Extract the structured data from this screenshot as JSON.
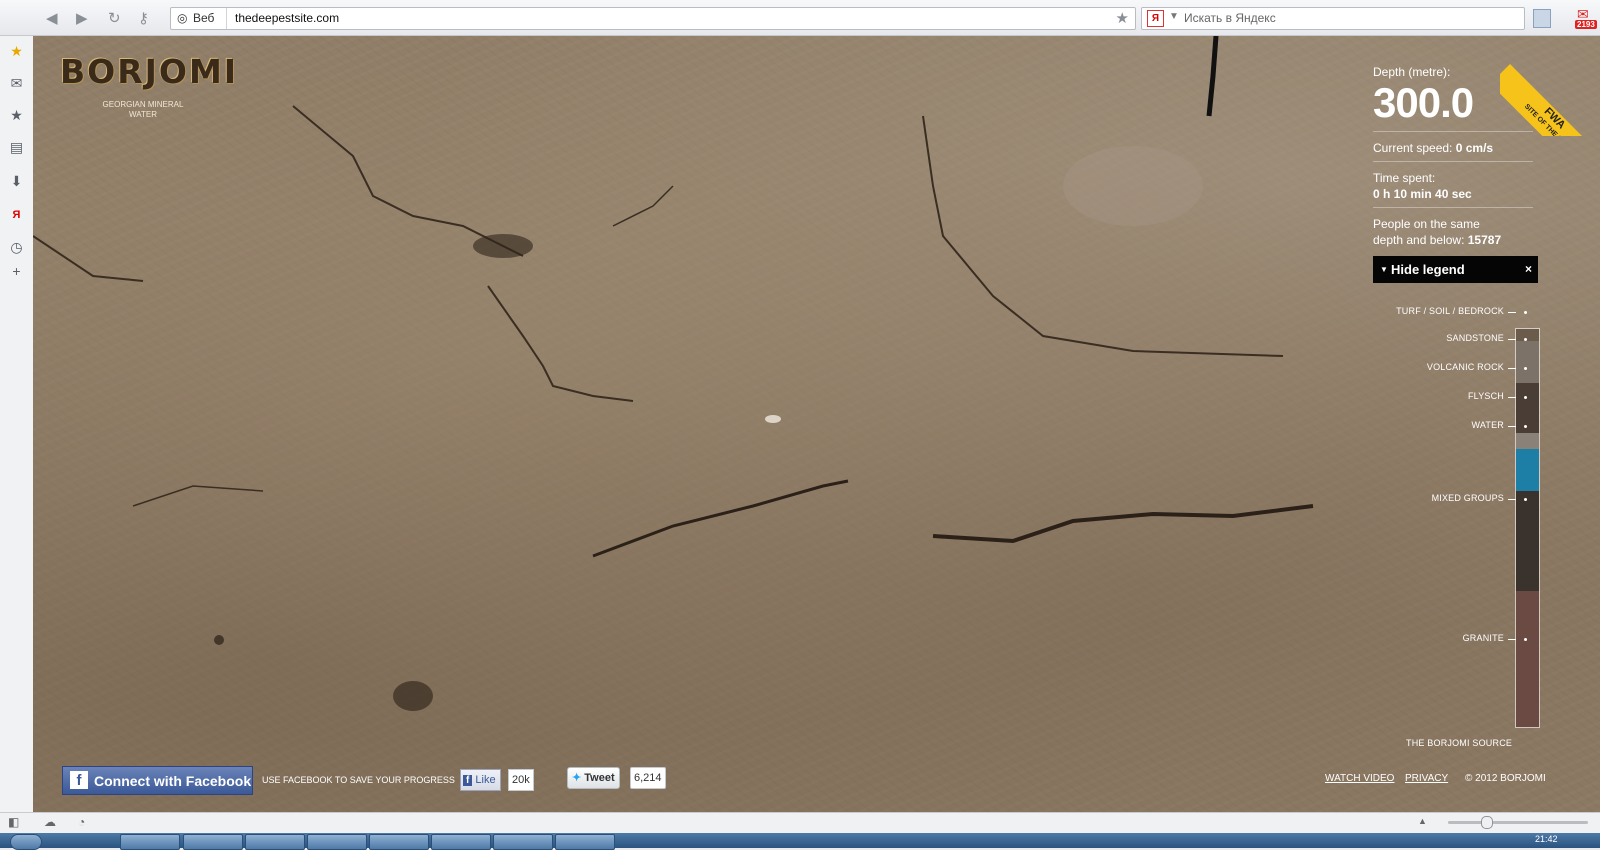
{
  "browser": {
    "url_web_label": "Веб",
    "url": "thedeepestsite.com",
    "search_placeholder": "Искать в Яндекс",
    "search_engine_logo": "Я",
    "mail_badge": "2193"
  },
  "sidebar": {
    "icons": [
      "star-icon",
      "mail-icon",
      "bookmark-star-icon",
      "note-icon",
      "download-icon",
      "yandex-icon",
      "history-icon",
      "add-icon"
    ]
  },
  "site": {
    "logo": "BORJOMI",
    "logo_sub": "GEORGIAN MINERAL WATER",
    "fwa_badge": "FWA",
    "fwa_sub": "SITE OF THE DAY"
  },
  "depth_panel": {
    "depth_label": "Depth (metre):",
    "depth_value": "300.0",
    "speed_label": "Current speed:",
    "speed_value": "0 cm/s",
    "time_label": "Time spent:",
    "time_value": "0 h 10 min 40 sec",
    "people_label_line1": "People on the same",
    "people_label_line2": "depth and below:",
    "people_value": "15787",
    "legend_button": "Hide legend",
    "legend_close": "×"
  },
  "strata": {
    "layers": [
      {
        "label": "TURF / SOIL / BEDROCK",
        "color": "#6b5b4a"
      },
      {
        "label": "SANDSTONE",
        "color": "#7d7268"
      },
      {
        "label": "VOLCANIC ROCK",
        "color": "#4a3d35"
      },
      {
        "label": "FLYSCH",
        "color": "#8a8178"
      },
      {
        "label": "WATER",
        "color": "#1d7ea6"
      },
      {
        "label": "MIXED GROUPS",
        "color": "#3a322c"
      },
      {
        "label": "GRANITE",
        "color": "#6a4a42"
      }
    ],
    "source_label": "THE BORJOMI SOURCE"
  },
  "footer": {
    "facebook_button": "Connect with Facebook",
    "facebook_hint": "USE FACEBOOK TO SAVE YOUR PROGRESS",
    "like_label": "Like",
    "like_count": "20k",
    "tweet_label": "Tweet",
    "tweet_count": "6,214",
    "watch_video": "WATCH VIDEO",
    "privacy": "PRIVACY",
    "copyright": "© 2012 BORJOMI"
  },
  "taskbar": {
    "clock": "21:42"
  },
  "colors": {
    "facebook_blue": "#3b5998",
    "fwa_yellow": "#f6c31a",
    "water_blue": "#1d7ea6"
  }
}
